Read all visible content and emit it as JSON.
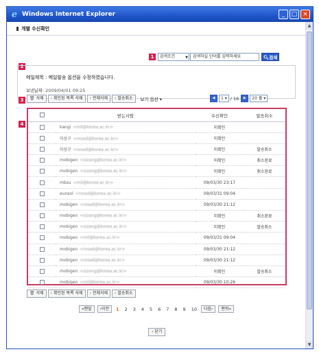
{
  "window": {
    "title": "Windows Internet Explorer"
  },
  "page": {
    "heading": "개별 수신확인"
  },
  "markers": [
    "1",
    "2",
    "3",
    "4"
  ],
  "search": {
    "condition": "검색조건",
    "placeholder": "검색하실 단어를 입력하세요",
    "button": "검색"
  },
  "mail": {
    "subject": "메일제목 : 메일발송 옵션을 수정하였습니다.",
    "sent": "보낸날짜: 2009/04/01 09:25"
  },
  "toolbar": {
    "delete": "삭제",
    "delete_confirmed": "확인된 목록 삭제",
    "delete_all": "전체삭제",
    "cancel_send": "발송취소",
    "view_options": "보기 옵션"
  },
  "pager_top": {
    "page": "1",
    "total": "/ 16",
    "rows": "20 줄"
  },
  "table": {
    "headers": {
      "recipient": "받는사람",
      "confirm": "수신확인",
      "cancel": "발송취소"
    },
    "rows": [
      {
        "name": "kangi",
        "email": "<mil@korea.ac.kr>",
        "confirm": "미확인",
        "cancel": ""
      },
      {
        "name": "이상구",
        "email": "<rosad@korea.ac.kr>",
        "confirm": "미확인",
        "cancel": ""
      },
      {
        "name": "이상구",
        "email": "<rosad@korea.ac.kr>",
        "confirm": "미확인",
        "cancel": "발송취소"
      },
      {
        "name": "mobigen",
        "email": "<sizang@korea.ac.kr>",
        "confirm": "미확인",
        "cancel": "취소완료"
      },
      {
        "name": "mobigen",
        "email": "<sizang@korea.ac.kr>",
        "confirm": "미확인",
        "cancel": "취소완료"
      },
      {
        "name": "mbsu",
        "email": "<mil@korea.ac.kr>",
        "confirm": "09/03/30 23:17",
        "cancel": ""
      },
      {
        "name": "eunsol",
        "email": "<rosad@korea.ac.kr>",
        "confirm": "09/03/31 09:04",
        "cancel": ""
      },
      {
        "name": "mobigen",
        "email": "<rosad@korea.ac.kr>",
        "confirm": "09/03/30 21:12",
        "cancel": ""
      },
      {
        "name": "mobigen",
        "email": "<sizang@korea.ac.kr>",
        "confirm": "미확인",
        "cancel": "취소완료"
      },
      {
        "name": "mobigen",
        "email": "<sizang@korea.ac.kr>",
        "confirm": "미확인",
        "cancel": "발송취소"
      },
      {
        "name": "mobigen",
        "email": "<mil@korea.ac.kr>",
        "confirm": "09/03/31 09:04",
        "cancel": ""
      },
      {
        "name": "mobigen",
        "email": "<rosad@korea.ac.kr>",
        "confirm": "09/03/30 21:12",
        "cancel": ""
      },
      {
        "name": "mobigen",
        "email": "<rosad@korea.ac.kr>",
        "confirm": "09/03/30 21:12",
        "cancel": ""
      },
      {
        "name": "mobigen",
        "email": "<sizang@korea.ac.kr>",
        "confirm": "미확인",
        "cancel": "발송취소"
      },
      {
        "name": "mobigen",
        "email": "<mil@korea.ac.kr>",
        "confirm": "09/03/30 10:26",
        "cancel": ""
      }
    ]
  },
  "pager_bottom": {
    "first": "맨앞",
    "prev": "이전",
    "pages": [
      "1",
      "2",
      "3",
      "4",
      "5",
      "6",
      "7",
      "8",
      "9",
      "10"
    ],
    "current": "1",
    "next": "다음",
    "last": "맨뒤"
  },
  "close_button": "닫기",
  "colors": {
    "accent": "#d81e4a",
    "titlebar": "#1f55c9",
    "search_button": "#2b5bc9"
  }
}
